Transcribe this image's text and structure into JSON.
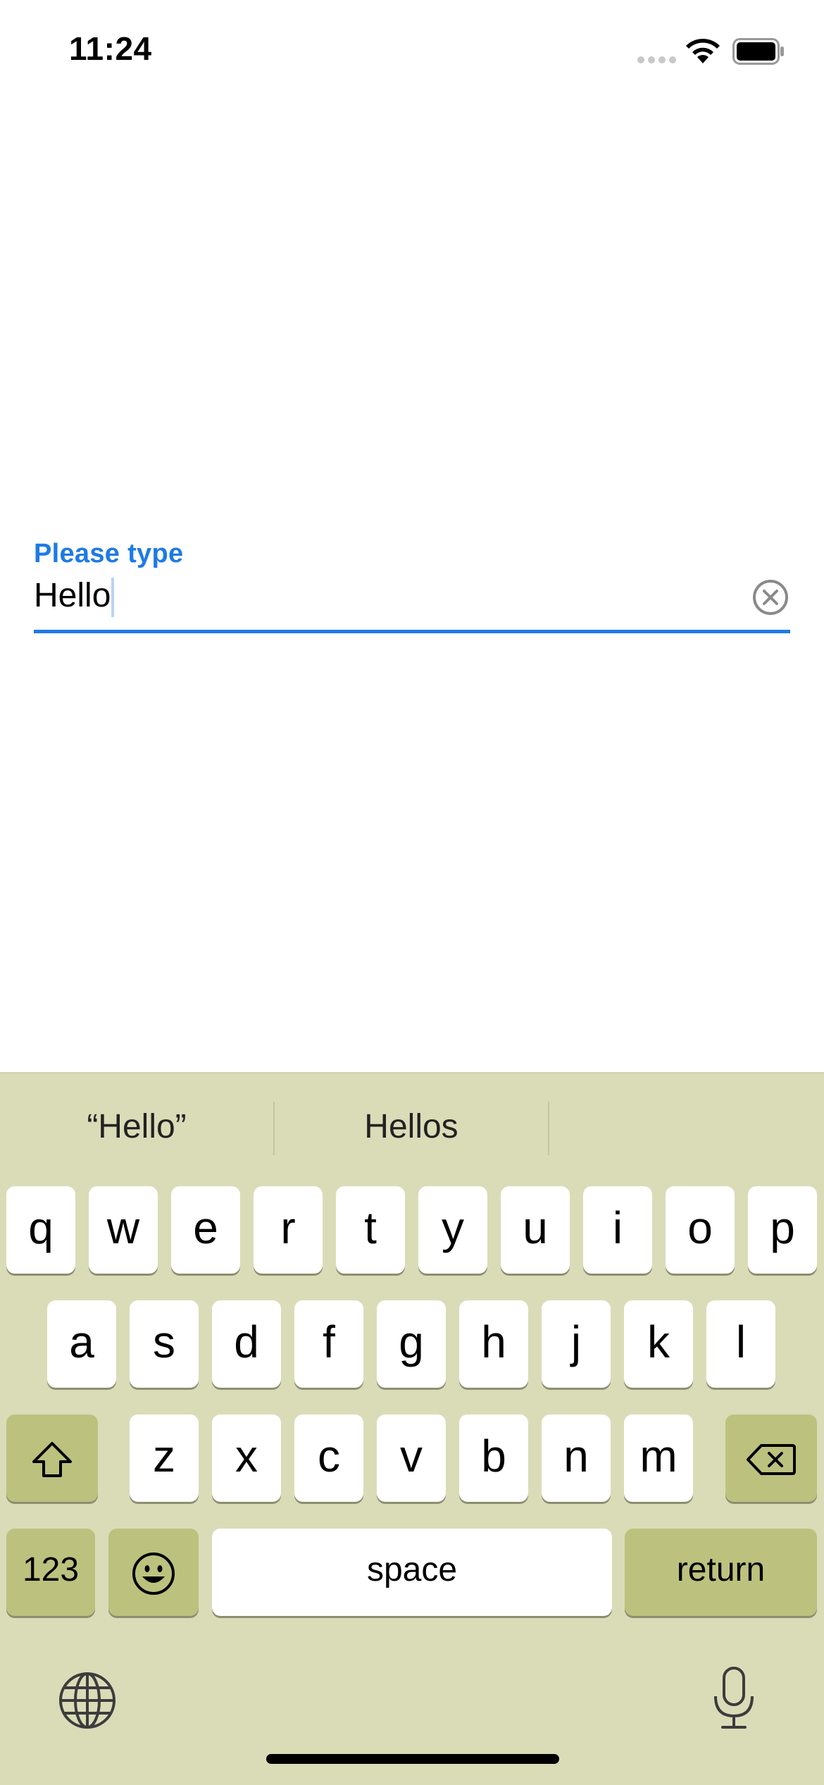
{
  "status_bar": {
    "time": "11:24"
  },
  "text_field": {
    "label": "Please type",
    "value": "Hello"
  },
  "keyboard": {
    "suggestions": [
      "“Hello”",
      "Hellos"
    ],
    "row1": [
      "q",
      "w",
      "e",
      "r",
      "t",
      "y",
      "u",
      "i",
      "o",
      "p"
    ],
    "row2": [
      "a",
      "s",
      "d",
      "f",
      "g",
      "h",
      "j",
      "k",
      "l"
    ],
    "row3": [
      "z",
      "x",
      "c",
      "v",
      "b",
      "n",
      "m"
    ],
    "numbers_label": "123",
    "space_label": "space",
    "return_label": "return",
    "icons": {
      "shift": "shift-icon",
      "delete": "backspace-icon",
      "emoji": "emoji-icon",
      "globe": "globe-icon",
      "mic": "microphone-icon"
    }
  },
  "colors": {
    "accent": "#1e7ae6",
    "keyboard_bg": "#dadcb8",
    "function_key": "#bcc17e"
  }
}
